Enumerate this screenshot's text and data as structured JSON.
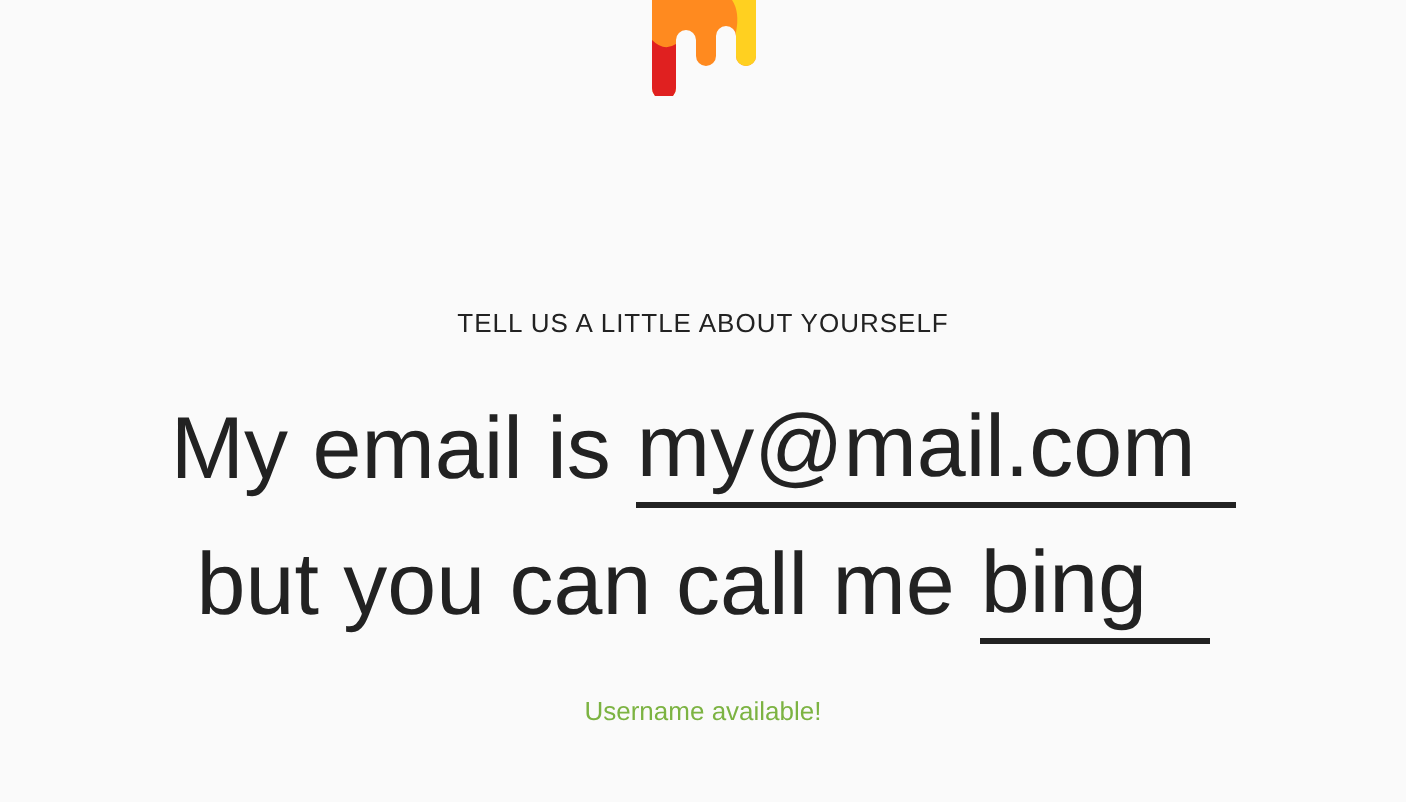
{
  "prompt": "TELL US A LITTLE ABOUT YOURSELF",
  "lines": [
    {
      "parts": [
        {
          "kind": "text",
          "text": "My email is"
        },
        {
          "kind": "field",
          "value": "my@mail.com"
        }
      ]
    },
    {
      "parts": [
        {
          "kind": "text",
          "text": "but you can call me"
        },
        {
          "kind": "field",
          "value": "bing"
        }
      ]
    }
  ],
  "status": {
    "kind": "success",
    "text": "Username available!"
  }
}
